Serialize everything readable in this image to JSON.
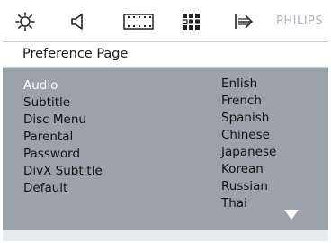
{
  "toolbar": {
    "icons": [
      "general-setup-icon",
      "audio-setup-icon",
      "video-setup-icon",
      "preference-setup-icon",
      "exit-icon"
    ],
    "brand": "PHILIPS"
  },
  "page": {
    "title": "Preference Page"
  },
  "menu": {
    "items": [
      "Audio",
      "Subtitle",
      "Disc Menu",
      "Parental",
      "Password",
      "DivX Subtitle",
      "Default"
    ],
    "selected": "Audio"
  },
  "options": {
    "items": [
      "Enlish",
      "French",
      "Spanish",
      "Chinese",
      "Japanese",
      "Korean",
      "Russian",
      "Thai"
    ],
    "scroll_icon": "scroll-down-arrow-icon"
  },
  "colors": {
    "panel": "#9ba2ab",
    "selected_text": "#ffffff",
    "text": "#111111",
    "brand": "#aeb4bd"
  }
}
